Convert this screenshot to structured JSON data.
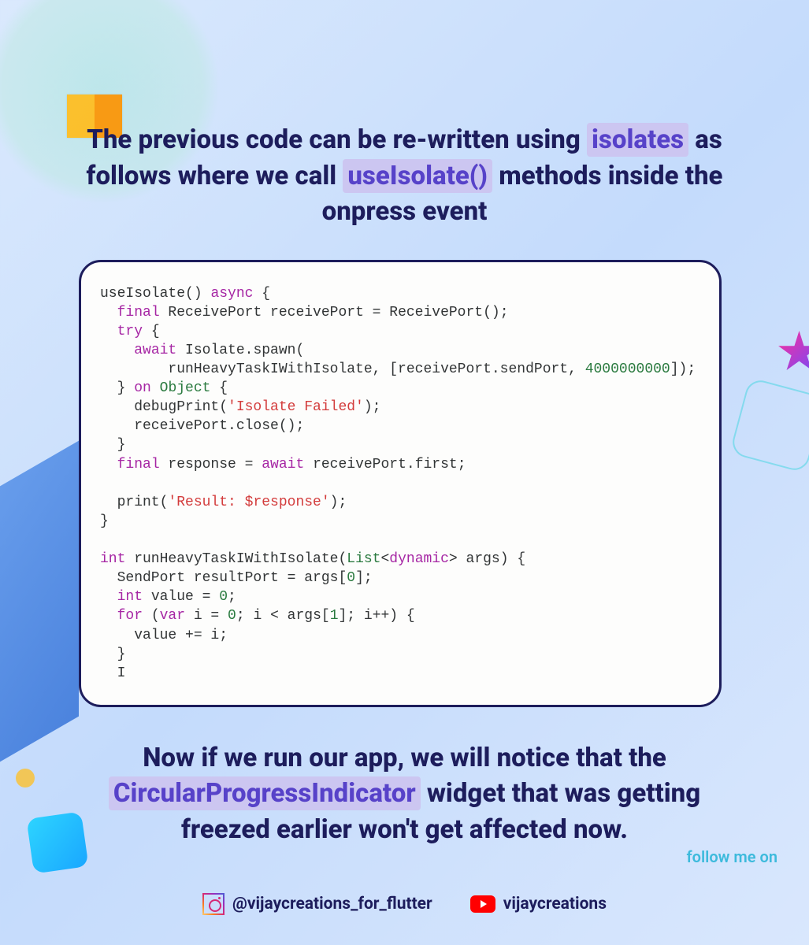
{
  "heading1": {
    "pre": "The previous code can be re-written using ",
    "hl1": "isolates",
    "mid": " as follows where we call ",
    "hl2": "useIsolate()",
    "post": " methods inside the onpress event"
  },
  "code": {
    "l1a": "useIsolate() ",
    "l1b": "async",
    "l1c": " {",
    "l2a": "  ",
    "l2b": "final",
    "l2c": " ReceivePort receivePort = ReceivePort();",
    "l3a": "  ",
    "l3b": "try",
    "l3c": " {",
    "l4a": "    ",
    "l4b": "await",
    "l4c": " Isolate.spawn(",
    "l5a": "        runHeavyTaskIWithIsolate, [receivePort.sendPort, ",
    "l5b": "4000000000",
    "l5c": "]);",
    "l6a": "  } ",
    "l6b": "on",
    "l6c": " ",
    "l6d": "Object",
    "l6e": " {",
    "l7a": "    debugPrint(",
    "l7b": "'Isolate Failed'",
    "l7c": ");",
    "l8": "    receivePort.close();",
    "l9": "  }",
    "l10a": "  ",
    "l10b": "final",
    "l10c": " response = ",
    "l10d": "await",
    "l10e": " receivePort.first;",
    "l11": "",
    "l12a": "  print(",
    "l12b": "'Result: $response'",
    "l12c": ");",
    "l13": "}",
    "l14": "",
    "l15a": "int",
    "l15b": " runHeavyTaskIWithIsolate(",
    "l15c": "List",
    "l15d": "<",
    "l15e": "dynamic",
    "l15f": "> args) {",
    "l16a": "  SendPort resultPort = args[",
    "l16b": "0",
    "l16c": "];",
    "l17a": "  ",
    "l17b": "int",
    "l17c": " value = ",
    "l17d": "0",
    "l17e": ";",
    "l18a": "  ",
    "l18b": "for",
    "l18c": " (",
    "l18d": "var",
    "l18e": " i = ",
    "l18f": "0",
    "l18g": "; i < args[",
    "l18h": "1",
    "l18i": "]; i++) {",
    "l19": "    value += i;",
    "l20": "  }",
    "l21": "  I"
  },
  "heading2": {
    "pre": "Now if we run our app, we will notice that the ",
    "hl": "CircularProgressIndicator",
    "post": " widget that was getting freezed earlier won't get affected now."
  },
  "follow": "follow me on",
  "social": {
    "instagram": "@vijaycreations_for_flutter",
    "youtube": "vijaycreations"
  }
}
